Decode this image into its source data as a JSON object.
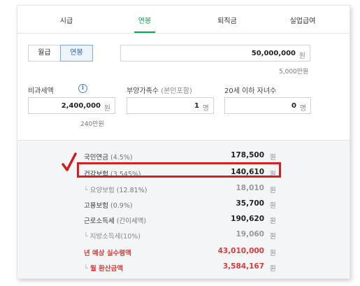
{
  "tabs": [
    {
      "label": "시급"
    },
    {
      "label": "연봉"
    },
    {
      "label": "퇴직금"
    },
    {
      "label": "실업급여"
    }
  ],
  "active_tab": "연봉",
  "pay_type": {
    "monthly": "월급",
    "annual": "연봉"
  },
  "salary": {
    "value": "50,000,000",
    "unit": "원",
    "sub": "5,000만원"
  },
  "nontax": {
    "label": "비과세액",
    "value": "2,400,000",
    "unit": "원",
    "sub": "240만원"
  },
  "dependents": {
    "label": "부양가족수",
    "label_paren": "(본인포함)",
    "value": "1",
    "unit": "명"
  },
  "children": {
    "label": "20세 이하 자녀수",
    "value": "0",
    "unit": "명"
  },
  "results": [
    {
      "label": "국민연금",
      "paren": "(4.5%)",
      "value": "178,500",
      "unit": "원"
    },
    {
      "label": "건강보험",
      "paren": "(3.545%)",
      "value": "140,610",
      "unit": "원"
    },
    {
      "label": "요양보험",
      "paren": "(12.81%)",
      "value": "18,010",
      "unit": "원"
    },
    {
      "label": "고용보험",
      "paren": "(0.9%)",
      "value": "35,700",
      "unit": "원"
    },
    {
      "label": "근로소득세",
      "paren": "(간이세액)",
      "value": "190,620",
      "unit": "원"
    },
    {
      "label": "지방소득세(10%)",
      "paren": "",
      "value": "19,060",
      "unit": "원"
    },
    {
      "label": "년 예상 실수령액",
      "paren": "",
      "value": "43,010,000",
      "unit": "원"
    },
    {
      "label": "월 환산금액",
      "paren": "",
      "value": "3,584,167",
      "unit": "원"
    }
  ],
  "colors": {
    "accent": "#03a94d",
    "highlight": "#d62020",
    "net": "#e03a3a"
  }
}
